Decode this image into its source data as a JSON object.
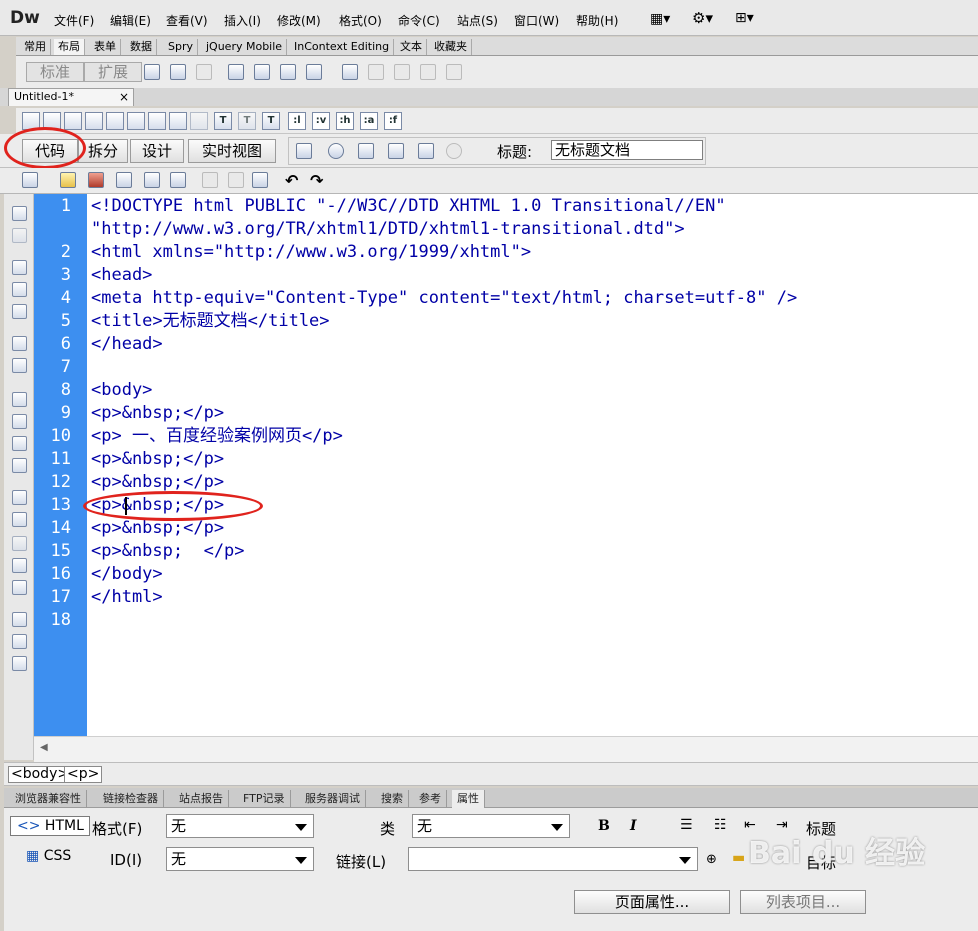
{
  "app": {
    "logo": "Dw"
  },
  "menu": [
    "文件(F)",
    "编辑(E)",
    "查看(V)",
    "插入(I)",
    "修改(M)",
    "格式(O)",
    "命令(C)",
    "站点(S)",
    "窗口(W)",
    "帮助(H)"
  ],
  "insert_tabs": [
    "常用",
    "布局",
    "表单",
    "数据",
    "Spry",
    "jQuery Mobile",
    "InContext Editing",
    "文本",
    "收藏夹"
  ],
  "insert_active": 1,
  "layout_modes": [
    "标准",
    "扩展"
  ],
  "document": {
    "tab_title": "Untitled-1*",
    "close": "×"
  },
  "coding_toolbar_labels": [
    ":l",
    ":v",
    ":h",
    ":a",
    ":f"
  ],
  "view_buttons": [
    "代码",
    "拆分",
    "设计",
    "实时视图"
  ],
  "page_title_label": "标题:",
  "page_title_value": "无标题文档",
  "code_lines": [
    "<!DOCTYPE html PUBLIC \"-//W3C//DTD XHTML 1.0 Transitional//EN\"",
    "\"http://www.w3.org/TR/xhtml1/DTD/xhtml1-transitional.dtd\">",
    "<html xmlns=\"http://www.w3.org/1999/xhtml\">",
    "<head>",
    "<meta http-equiv=\"Content-Type\" content=\"text/html; charset=utf-8\" />",
    "<title>无标题文档</title>",
    "</head>",
    "",
    "<body>",
    "<p>&nbsp;</p>",
    "<p> 一、百度经验案例网页</p>",
    "<p>&nbsp;</p>",
    "<p>&nbsp;</p>",
    "<p>&nbsp;</p>",
    "<p>&nbsp;</p>",
    "<p>&nbsp;  </p>",
    "</body>",
    "</html>",
    ""
  ],
  "line_numbers": [
    "1",
    "2",
    "3",
    "4",
    "5",
    "6",
    "7",
    "8",
    "9",
    "10",
    "11",
    "12",
    "13",
    "14",
    "15",
    "16",
    "17",
    "18"
  ],
  "tag_selector": [
    "<body>",
    "<p>"
  ],
  "panel_tabs": [
    "浏览器兼容性",
    "链接检查器",
    "站点报告",
    "FTP记录",
    "服务器调试",
    "搜索",
    "参考",
    "属性"
  ],
  "panel_active": 7,
  "properties": {
    "html_btn": "HTML",
    "css_btn": "CSS",
    "format_label": "格式(F)",
    "format_value": "无",
    "id_label": "ID(I)",
    "id_value": "无",
    "class_label": "类",
    "class_value": "无",
    "link_label": "链接(L)",
    "link_value": "",
    "bold": "B",
    "italic": "I",
    "heading_label": "标题",
    "target_label": "目标",
    "page_props_btn": "页面属性...",
    "list_items_btn": "列表项目..."
  },
  "colors": {
    "gutter": "#3d8ff0",
    "tag": "#0000a6",
    "annotation": "#e0231d"
  },
  "watermark": "Bai du 经验"
}
